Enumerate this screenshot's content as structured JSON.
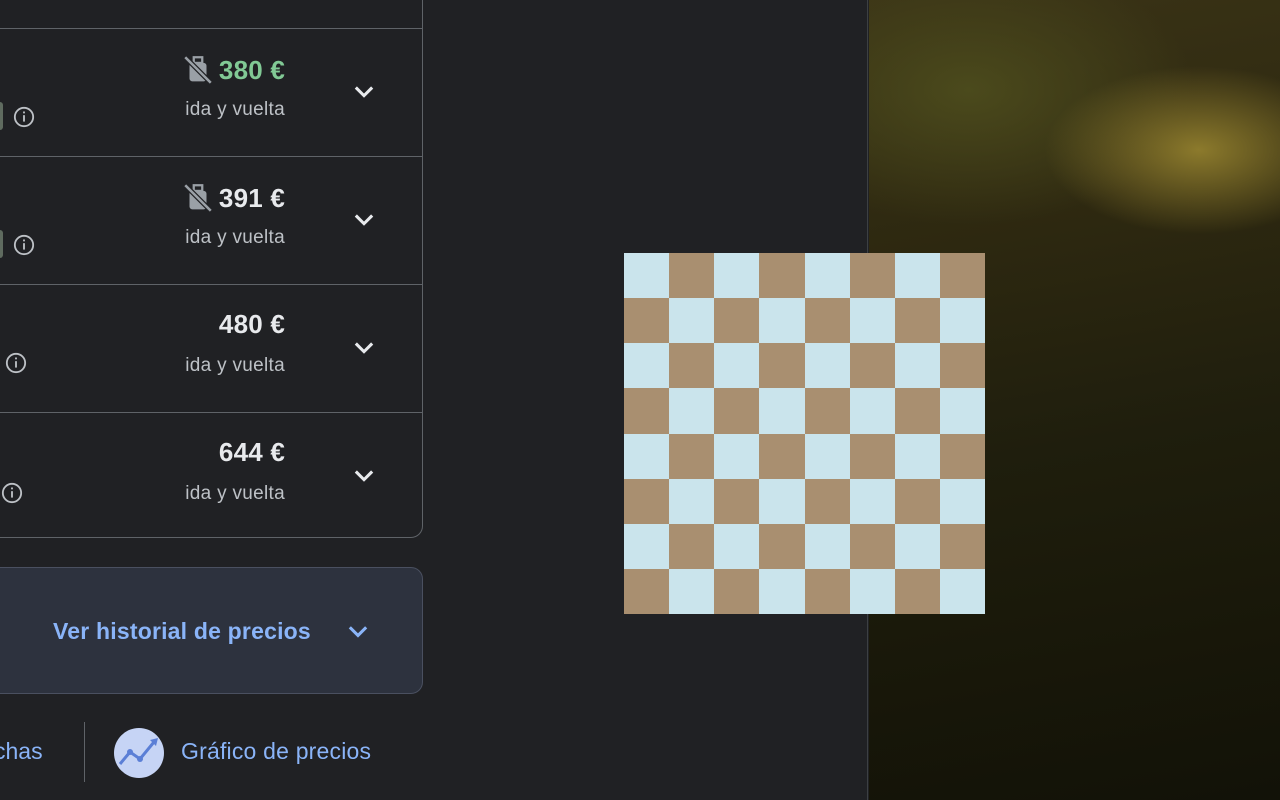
{
  "results": [
    {
      "price": "380 €",
      "highlight": true,
      "no_bag": true,
      "trip": "ida y vuelta"
    },
    {
      "price": "391 €",
      "highlight": false,
      "no_bag": true,
      "trip": "ida y vuelta"
    },
    {
      "price": "480 €",
      "highlight": false,
      "no_bag": false,
      "trip": "ida y vuelta"
    },
    {
      "price": "644 €",
      "highlight": false,
      "no_bag": false,
      "trip": "ida y vuelta"
    }
  ],
  "price_history": {
    "label": "Ver historial de precios"
  },
  "bottom_bar": {
    "dates_label": "chas",
    "chart_label": "Gráfico de precios"
  },
  "colors": {
    "accent": "#8ab4f8",
    "price_green": "#81c995",
    "text": "#e8eaed"
  }
}
